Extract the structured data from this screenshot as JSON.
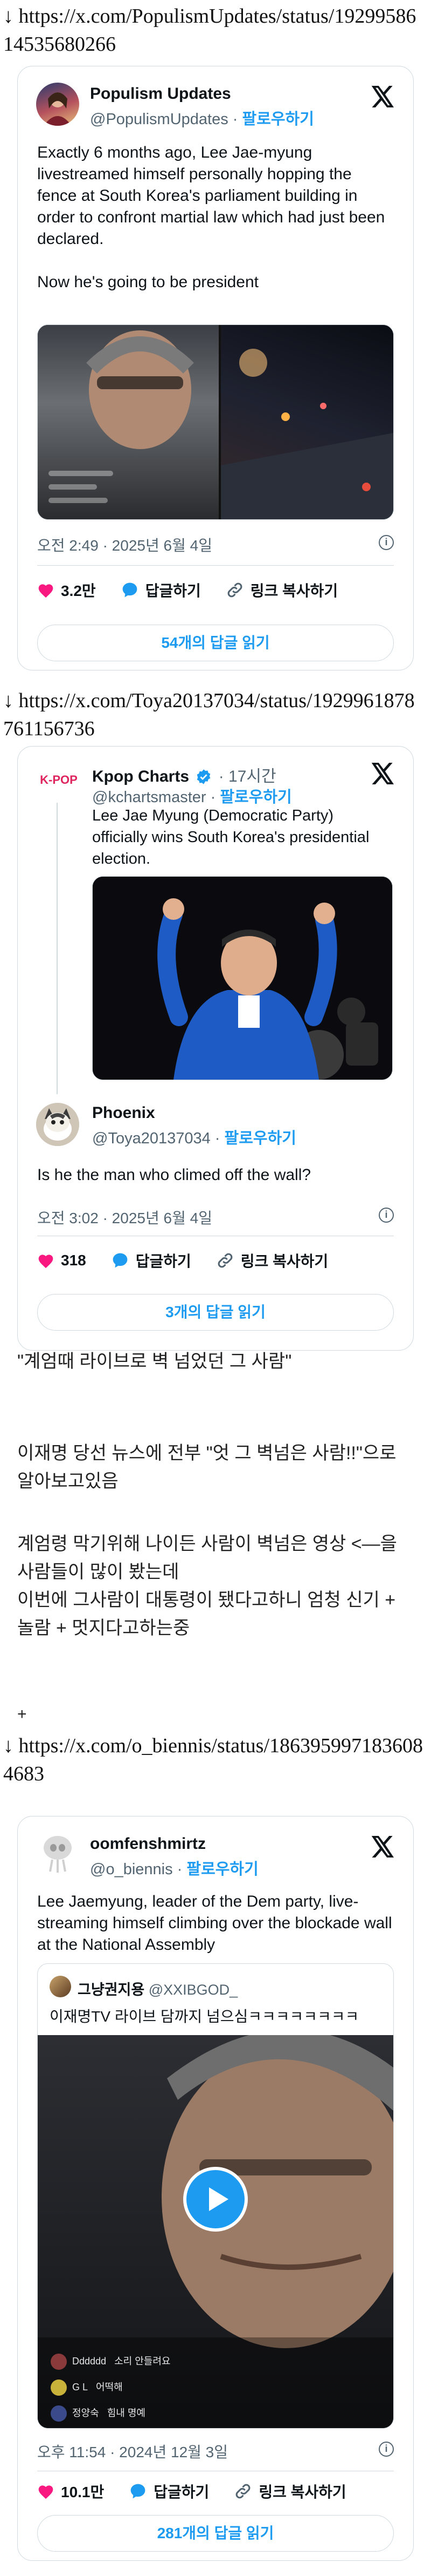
{
  "links": {
    "link1": "↓ https://x.com/PopulismUpdates/status/1929958614535680266",
    "link2": "↓ https://x.com/Toya20137034/status/1929961878761156736",
    "link3": "↓ https://x.com/o_biennis/status/1863959971836084683"
  },
  "tweet1": {
    "name": "Populism Updates",
    "handle": "@PopulismUpdates",
    "follow": "팔로우하기",
    "text": "Exactly 6 months ago, Lee Jae-myung livestreamed himself personally hopping the fence at South Korea's parliament building in order to confront martial law which had just been declared.\n\nNow he's going to be president",
    "timestamp": "오전 2:49 · 2025년 6월 4일",
    "likes": "3.2만",
    "reply": "답글하기",
    "copy_link": "링크 복사하기",
    "read_replies": "54개의 답글 읽기"
  },
  "tweet2": {
    "quoted": {
      "name": "Kpop Charts",
      "logo_text": "K-POP",
      "time": "· 17시간",
      "handle": "@kchartsmaster",
      "follow": "팔로우하기",
      "text": "Lee Jae Myung (Democratic Party) officially wins South Korea's presidential election."
    },
    "name": "Phoenix",
    "handle": "@Toya20137034",
    "follow": "팔로우하기",
    "text": "Is he the man who climed off the wall?",
    "timestamp": "오전 3:02 · 2025년 6월 4일",
    "likes": "318",
    "reply": "답글하기",
    "copy_link": "링크 복사하기",
    "read_replies": "3개의 답글 읽기"
  },
  "commentary": {
    "line1": "\"계엄때 라이브로 벽 넘었던 그 사람\"",
    "line2": "이재명 당선 뉴스에 전부 \"엇 그 벽넘은 사람!!\"으로 알아보고있음",
    "line3": "계엄령 막기위해 나이든 사람이 벽넘은 영상 <—을 사람들이 많이 봤는데",
    "line4": "이번에 그사람이 대통령이 됐다고하니 엄청 신기 + 놀람 + 멋지다고하는중",
    "plus": "+"
  },
  "tweet3": {
    "name": "oomfenshmirtz",
    "handle": "@o_biennis",
    "follow": "팔로우하기",
    "text": "Lee Jaemyung, leader of the Dem party, live-streaming himself climbing over the blockade wall at the National Assembly",
    "quoted": {
      "name": "그냥권지용",
      "handle": "@XXIBGOD_",
      "text": "이재명TV 라이브 담까지 넘으심ㅋㅋㅋㅋㅋㅋㅋㅋ"
    },
    "video_comments": [
      {
        "user": "Dddddd",
        "msg": "소리 안들려요"
      },
      {
        "user": "G L",
        "msg": "어떡해"
      },
      {
        "user": "정양숙",
        "msg": "힘내 명예"
      }
    ],
    "timestamp": "오후 11:54 · 2024년 12월 3일",
    "likes": "10.1만",
    "reply": "답글하기",
    "copy_link": "링크 복사하기",
    "read_replies": "281개의 답글 읽기"
  },
  "colors": {
    "accent": "#1d9bf0",
    "like": "#f91880",
    "text": "#0f1419",
    "muted": "#536471",
    "border": "#cfd9de"
  },
  "icons": [
    "heart-icon",
    "reply-bubble-icon",
    "link-icon",
    "info-icon",
    "x-logo-icon",
    "verified-badge-icon",
    "play-icon"
  ]
}
